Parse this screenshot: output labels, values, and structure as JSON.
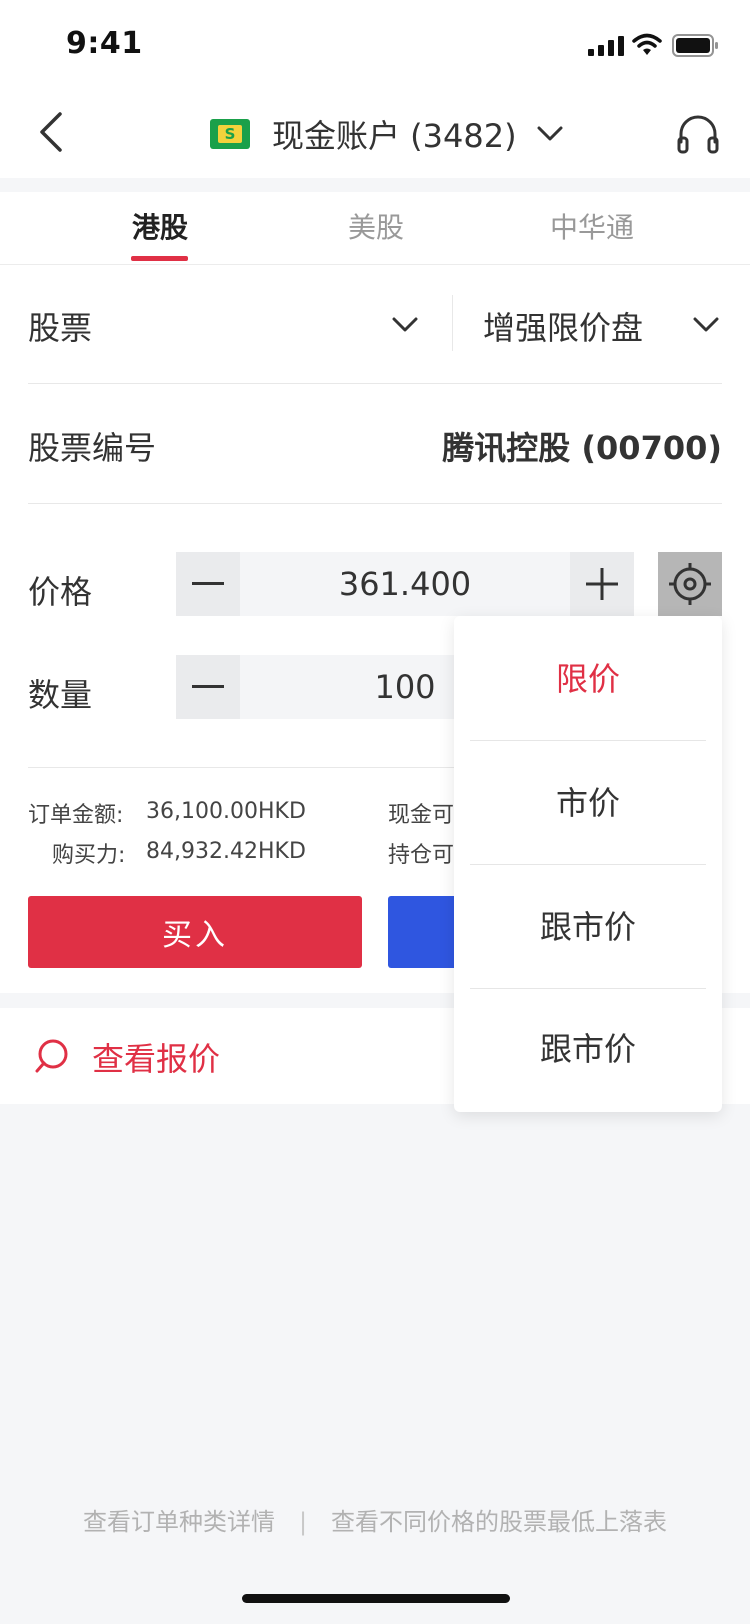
{
  "status_bar": {
    "time": "9:41"
  },
  "header": {
    "title": "现金账户 (3482)",
    "account_icon_glyph": "S"
  },
  "tabs": [
    {
      "label": "港股",
      "active": true
    },
    {
      "label": "美股",
      "active": false
    },
    {
      "label": "中华通",
      "active": false
    }
  ],
  "form": {
    "product_type": "股票",
    "order_type": "增强限价盘",
    "stock_code_label": "股票编号",
    "stock_name": "腾讯控股 (00700)",
    "price_label": "价格",
    "price_value": "361.400",
    "quantity_label": "数量",
    "quantity_value": "100",
    "order_amount_label": "订单金额:",
    "order_amount_value": "36,100.00",
    "order_amount_currency": "HKD",
    "buying_power_label": "购买力:",
    "buying_power_value": "84,932.42",
    "buying_power_currency": "HKD",
    "cash_available_label": "现金可",
    "holding_available_label": "持仓可",
    "buy_label": "买入"
  },
  "quote": {
    "label": "查看报价"
  },
  "dropdown": {
    "items": [
      {
        "label": "限价",
        "selected": true
      },
      {
        "label": "市价",
        "selected": false
      },
      {
        "label": "跟市价",
        "selected": false
      },
      {
        "label": "跟市价",
        "selected": false
      }
    ]
  },
  "footer": {
    "link1": "查看订单种类详情",
    "separator": "|",
    "link2": "查看不同价格的股票最低上落表"
  },
  "colors": {
    "accent_red": "#e03045",
    "sell_blue": "#2f56e0",
    "account_green": "#1aa04a"
  }
}
